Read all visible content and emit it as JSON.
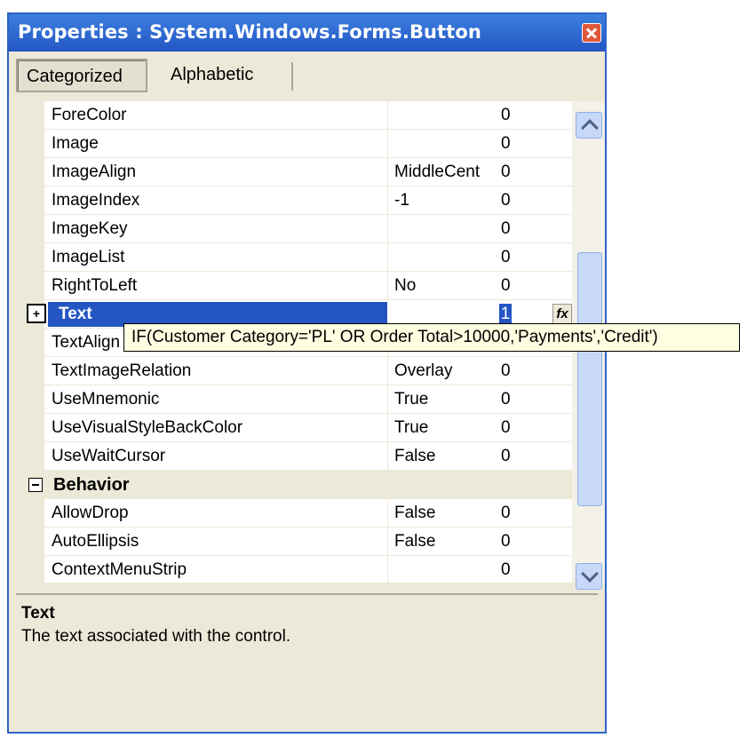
{
  "window": {
    "title": "Properties : System.Windows.Forms.Button"
  },
  "tabs": {
    "categorized": "Categorized",
    "alphabetic": "Alphabetic"
  },
  "rows_top": [
    {
      "name": "ForeColor",
      "value": "",
      "num": "0"
    },
    {
      "name": "Image",
      "value": "",
      "num": "0"
    },
    {
      "name": "ImageAlign",
      "value": "MiddleCent",
      "num": "0"
    },
    {
      "name": "ImageIndex",
      "value": "-1",
      "num": "0"
    },
    {
      "name": "ImageKey",
      "value": "",
      "num": "0"
    },
    {
      "name": "ImageList",
      "value": "",
      "num": "0"
    },
    {
      "name": "RightToLeft",
      "value": "No",
      "num": "0"
    }
  ],
  "selected_row": {
    "expander": "+",
    "name": "Text",
    "num": "1",
    "fx": "fx"
  },
  "rows_mid": [
    {
      "name": "TextAlign",
      "value": "",
      "num": ""
    },
    {
      "name": "TextImageRelation",
      "value": "Overlay",
      "num": "0"
    },
    {
      "name": "UseMnemonic",
      "value": "True",
      "num": "0"
    },
    {
      "name": "UseVisualStyleBackColor",
      "value": "True",
      "num": "0"
    },
    {
      "name": "UseWaitCursor",
      "value": "False",
      "num": "0"
    }
  ],
  "category": {
    "label": "Behavior"
  },
  "rows_bottom": [
    {
      "name": "AllowDrop",
      "value": "False",
      "num": "0"
    },
    {
      "name": "AutoEllipsis",
      "value": "False",
      "num": "0"
    },
    {
      "name": "ContextMenuStrip",
      "value": "",
      "num": "0"
    }
  ],
  "tooltip": {
    "text": "IF(Customer Category='PL' OR Order Total>10000,'Payments','Credit')"
  },
  "help": {
    "title": "Text",
    "description": "The text associated with the control."
  },
  "colors": {
    "titlebar": "#2456c3",
    "selection": "#2456c3",
    "window_bg": "#ece9d8",
    "tooltip_bg": "#ffffe1"
  }
}
